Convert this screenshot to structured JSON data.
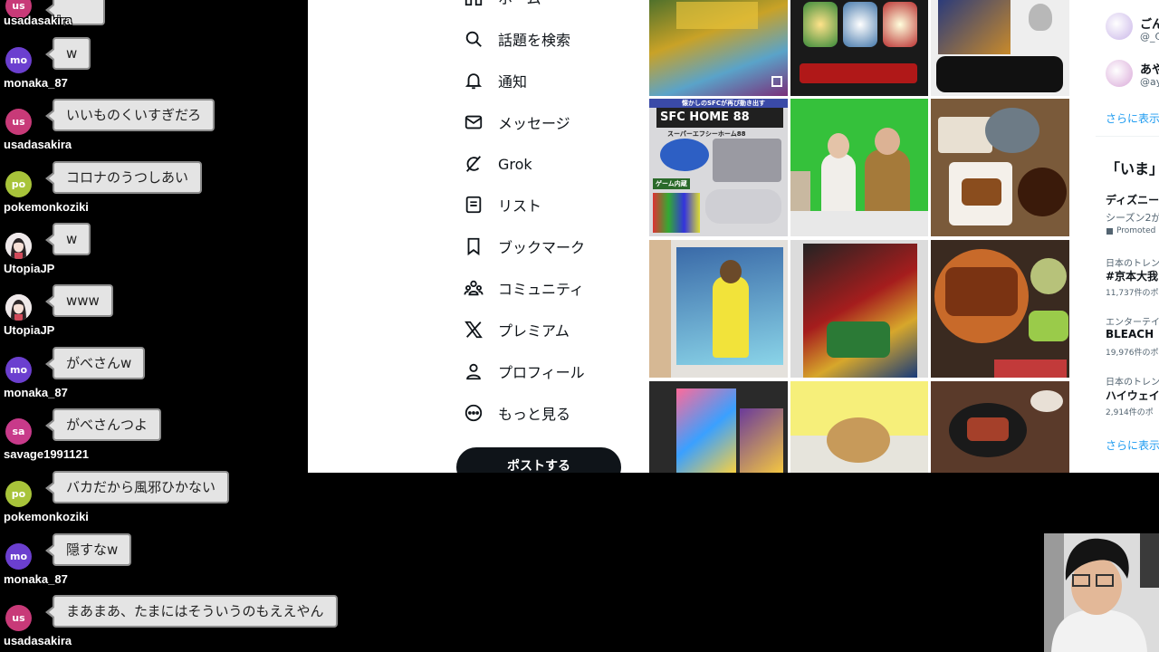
{
  "chat": {
    "messages": [
      {
        "user": "usadasakira",
        "avatar": "us",
        "avatar_color": "#c83a78",
        "text": ""
      },
      {
        "user": "monaka_87",
        "avatar": "mo",
        "avatar_color": "#6b3fcf",
        "text": "w"
      },
      {
        "user": "usadasakira",
        "avatar": "us",
        "avatar_color": "#c83a78",
        "text": "いいものくいすぎだろ"
      },
      {
        "user": "pokemonkoziki",
        "avatar": "po",
        "avatar_color": "#a8c43a",
        "text": "コロナのうつしあい"
      },
      {
        "user": "UtopiaJP",
        "avatar": "",
        "avatar_color": "",
        "text": "w"
      },
      {
        "user": "UtopiaJP",
        "avatar": "",
        "avatar_color": "",
        "text": "www"
      },
      {
        "user": "monaka_87",
        "avatar": "mo",
        "avatar_color": "#6b3fcf",
        "text": "がべさんw"
      },
      {
        "user": "savage1991121",
        "avatar": "sa",
        "avatar_color": "#c83a8a",
        "text": "がべさんつよ"
      },
      {
        "user": "pokemonkoziki",
        "avatar": "po",
        "avatar_color": "#a8c43a",
        "text": "バカだから風邪ひかない"
      },
      {
        "user": "monaka_87",
        "avatar": "mo",
        "avatar_color": "#6b3fcf",
        "text": "隠すなw"
      },
      {
        "user": "usadasakira",
        "avatar": "us",
        "avatar_color": "#c83a78",
        "text": "まあまあ、たまにはそういうのもええやん"
      }
    ]
  },
  "x_nav": {
    "items": [
      {
        "label": "ホーム",
        "icon": "home-icon"
      },
      {
        "label": "話題を検索",
        "icon": "search-icon"
      },
      {
        "label": "通知",
        "icon": "bell-icon"
      },
      {
        "label": "メッセージ",
        "icon": "mail-icon"
      },
      {
        "label": "Grok",
        "icon": "grok-icon"
      },
      {
        "label": "リスト",
        "icon": "list-icon"
      },
      {
        "label": "ブックマーク",
        "icon": "bookmark-icon"
      },
      {
        "label": "コミュニティ",
        "icon": "community-icon"
      },
      {
        "label": "プレミアム",
        "icon": "x-logo-icon"
      },
      {
        "label": "プロフィール",
        "icon": "profile-icon"
      },
      {
        "label": "もっと見る",
        "icon": "more-icon"
      }
    ],
    "post_label": "ポストする"
  },
  "media_grid": {
    "tile_texts": {
      "sfc_title": "SFC HOME 88",
      "sfc_sub": "スーパーエフシーホーム88",
      "sfc_top": "懐かしのSFCが再び動き出す",
      "sfc_badge": "ゲーム内蔵"
    }
  },
  "right_column": {
    "follow_name_1": "ごん",
    "follow_handle_1": "@_C",
    "follow_name_2": "あや",
    "follow_handle_2": "@ay",
    "show_more_1": "さらに表示",
    "trends_header": "「いま」",
    "trend_1_title": "ディズニー",
    "trend_1_sub": "シーズン2が",
    "trend_1_promoted": "Promoted",
    "trend_2_cat": "日本のトレン",
    "trend_2_title": "#京本大我",
    "trend_2_count": "11,737件のポ",
    "trend_3_cat": "エンターテイ",
    "trend_3_title": "BLEACH",
    "trend_3_count": "19,976件のポ",
    "trend_4_cat": "日本のトレン",
    "trend_4_title": "ハイウェイ",
    "trend_4_count": "2,914件のポ",
    "show_more_2": "さらに表示"
  },
  "colors": {
    "accent_link": "#1d9bf0",
    "text_primary": "#0f1419",
    "text_secondary": "#536471",
    "bubble_bg": "#e4e4e4",
    "bubble_border": "#8e8e8e"
  }
}
